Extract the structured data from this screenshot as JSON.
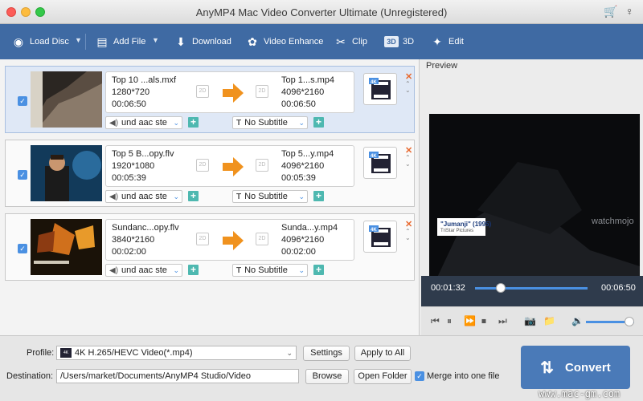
{
  "window": {
    "title": "AnyMP4 Mac Video Converter Ultimate (Unregistered)"
  },
  "toolbar": {
    "load_disc": "Load Disc",
    "add_file": "Add File",
    "download": "Download",
    "video_enhance": "Video Enhance",
    "clip": "Clip",
    "threed": "3D",
    "edit": "Edit"
  },
  "items": [
    {
      "src_name": "Top 10 ...als.mxf",
      "src_res": "1280*720",
      "src_dur": "00:06:50",
      "out_name": "Top 1...s.mp4",
      "out_res": "4096*2160",
      "out_dur": "00:06:50",
      "audio": "und aac ste",
      "subtitle": "No Subtitle",
      "badge": "2D"
    },
    {
      "src_name": "Top 5 B...opy.flv",
      "src_res": "1920*1080",
      "src_dur": "00:05:39",
      "out_name": "Top 5...y.mp4",
      "out_res": "4096*2160",
      "out_dur": "00:05:39",
      "audio": "und aac ste",
      "subtitle": "No Subtitle",
      "badge": "2D"
    },
    {
      "src_name": "Sundanc...opy.flv",
      "src_res": "3840*2160",
      "src_dur": "00:02:00",
      "out_name": "Sunda...y.mp4",
      "out_res": "4096*2160",
      "out_dur": "00:02:00",
      "audio": "und aac ste",
      "subtitle": "No Subtitle",
      "badge": "2D"
    }
  ],
  "preview": {
    "label": "Preview",
    "caption": "\"Jumanji\" (1995)",
    "caption_sub": "TriStar Pictures",
    "watermark": "watchmojo",
    "time_current": "00:01:32",
    "time_total": "00:06:50",
    "progress_fraction": 0.225
  },
  "bottom": {
    "profile_label": "Profile:",
    "profile_value": "4K H.265/HEVC Video(*.mp4)",
    "settings": "Settings",
    "apply_to_all": "Apply to All",
    "destination_label": "Destination:",
    "destination_value": "/Users/market/Documents/AnyMP4 Studio/Video",
    "browse": "Browse",
    "open_folder": "Open Folder",
    "merge": "Merge into one file",
    "convert": "Convert"
  },
  "site_watermark": "www.mac-gm.com",
  "colors": {
    "accent": "#4a90e2",
    "toolbar": "#3f6aa3",
    "arrow": "#f0921e",
    "convert": "#4a7ab8"
  }
}
